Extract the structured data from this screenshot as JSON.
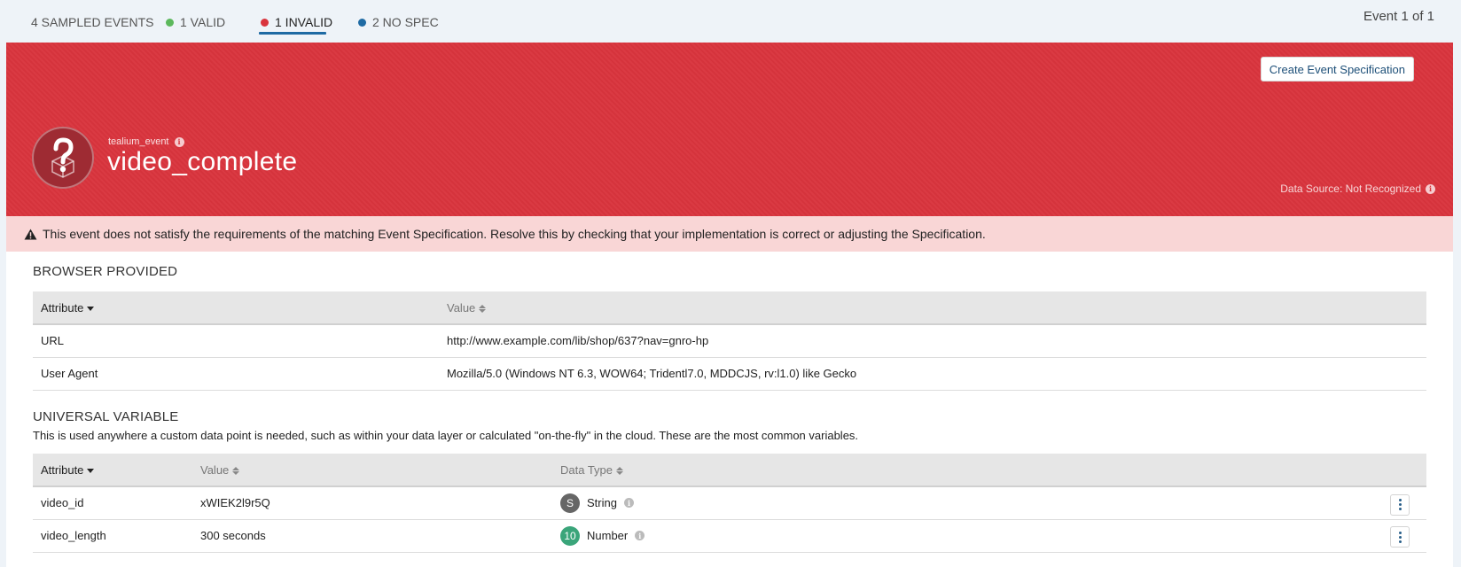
{
  "tabs": {
    "sampled": "4 SAMPLED EVENTS",
    "valid": "1 VALID",
    "invalid": "1 INVALID",
    "no_spec": "2 NO SPEC",
    "colors": {
      "valid": "#5cb85c",
      "invalid": "#d9343d",
      "no_spec": "#1e6aa3"
    }
  },
  "event_counter": "Event 1 of 1",
  "header": {
    "create_button": "Create Event Specification",
    "category": "tealium_event",
    "event_name": "video_complete",
    "data_source": "Data Source: Not Recognized",
    "color": "#d9343d"
  },
  "warning": {
    "text": "This event does not satisfy the requirements of the matching Event Specification. Resolve this by checking that your implementation is correct or adjusting the Specification."
  },
  "browser_provided": {
    "title": "BROWSER PROVIDED",
    "columns": {
      "attribute": "Attribute",
      "value": "Value"
    },
    "rows": [
      {
        "attribute": "URL",
        "value": "http://www.example.com/lib/shop/637?nav=gnro-hp"
      },
      {
        "attribute": "User Agent",
        "value": "Mozilla/5.0 (Windows NT 6.3, WOW64; Tridentl7.0, MDDCJS, rv:l1.0) like Gecko"
      }
    ]
  },
  "universal_variable": {
    "title": "UNIVERSAL VARIABLE",
    "description": "This is used anywhere a custom data point is needed, such as within your data layer or calculated \"on-the-fly\" in the cloud. These are the most common variables.",
    "columns": {
      "attribute": "Attribute",
      "value": "Value",
      "data_type": "Data Type"
    },
    "rows": [
      {
        "attribute": "video_id",
        "value": "xWIEK2l9r5Q",
        "type_badge": "S",
        "type_label": "String",
        "badge_color": "#666666"
      },
      {
        "attribute": "video_length",
        "value": "300 seconds",
        "type_badge": "10",
        "type_label": "Number",
        "badge_color": "#3aa57a"
      }
    ]
  }
}
